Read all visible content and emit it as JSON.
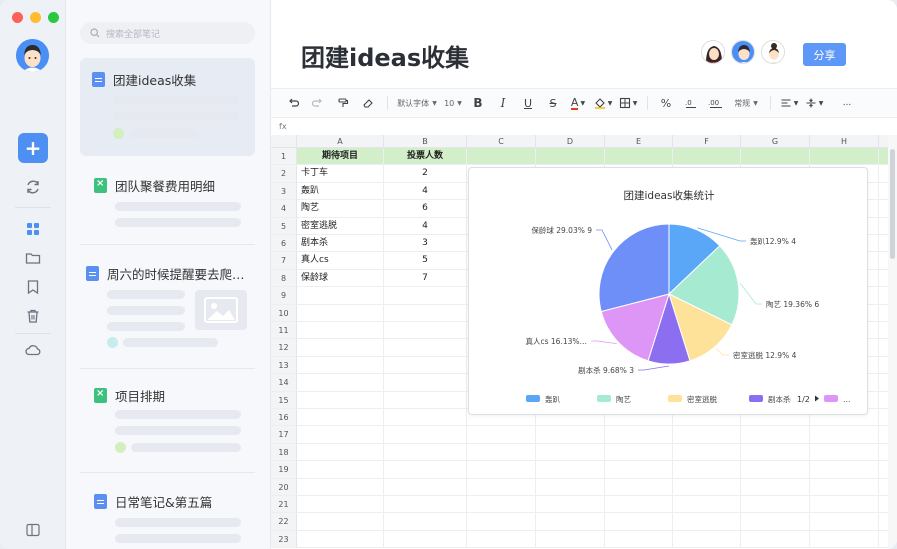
{
  "sidebar": {
    "search_placeholder": "搜索全部笔记",
    "notes": [
      {
        "title": "团建ideas收集",
        "type": "sheet"
      },
      {
        "title": "团队聚餐费用明细",
        "type": "excel"
      },
      {
        "title": "周六的时候提醒要去爬…",
        "type": "doc"
      },
      {
        "title": "项目排期",
        "type": "excel"
      },
      {
        "title": "日常笔记&第五篇",
        "type": "doc"
      }
    ]
  },
  "header": {
    "title": "团建ideas收集",
    "share_label": "分享"
  },
  "toolbar": {
    "font_family": "默认字体",
    "font_size": "10",
    "bold": "B",
    "italic": "I",
    "underline": "U",
    "strike": "S",
    "font_color": "A",
    "percent": "%",
    "number_format": "常规",
    "more": "..."
  },
  "formula_bar": {
    "label": "fx"
  },
  "sheet": {
    "columns": [
      "A",
      "B",
      "C",
      "D",
      "E",
      "F",
      "G",
      "H"
    ],
    "row_numbers": [
      "1",
      "2",
      "3",
      "4",
      "5",
      "6",
      "7",
      "8",
      "9",
      "10",
      "11",
      "12",
      "13",
      "14",
      "15",
      "16",
      "17",
      "18",
      "19",
      "20",
      "21",
      "22",
      "23"
    ],
    "header_row": [
      "期待项目",
      "投票人数"
    ],
    "rows": [
      [
        "卡丁车",
        "2"
      ],
      [
        "轰趴",
        "4"
      ],
      [
        "陶艺",
        "6"
      ],
      [
        "密室逃脱",
        "4"
      ],
      [
        "剧本杀",
        "3"
      ],
      [
        "真人cs",
        "5"
      ],
      [
        "保龄球",
        "7"
      ]
    ]
  },
  "chart_data": {
    "type": "pie",
    "title": "团建ideas收集统计",
    "slices": [
      {
        "label": "轰趴",
        "value": 4,
        "percent": "12.9%",
        "text": "轰趴12.9% 4",
        "color": "#5aa6f7"
      },
      {
        "label": "陶艺",
        "value": 6,
        "percent": "19.36%",
        "text": "陶艺 19.36% 6",
        "color": "#a5ead1"
      },
      {
        "label": "密室逃脱",
        "value": 4,
        "percent": "12.9%",
        "text": "密室逃脱 12.9% 4",
        "color": "#ffe29a"
      },
      {
        "label": "剧本杀",
        "value": 3,
        "percent": "9.68%",
        "text": "剧本杀 9.68% 3",
        "color": "#8c6ff0"
      },
      {
        "label": "真人cs",
        "value": 5,
        "percent": "16.13%",
        "text": "真人cs 16.13%…",
        "color": "#dd96f6"
      },
      {
        "label": "保龄球",
        "value": 9,
        "percent": "29.03%",
        "text": "保龄球 29.03% 9",
        "color": "#6d8ff7"
      }
    ],
    "legend": [
      "轰趴",
      "陶艺",
      "密室逃脱",
      "剧本杀",
      "…"
    ],
    "legend_page": "1/2"
  }
}
